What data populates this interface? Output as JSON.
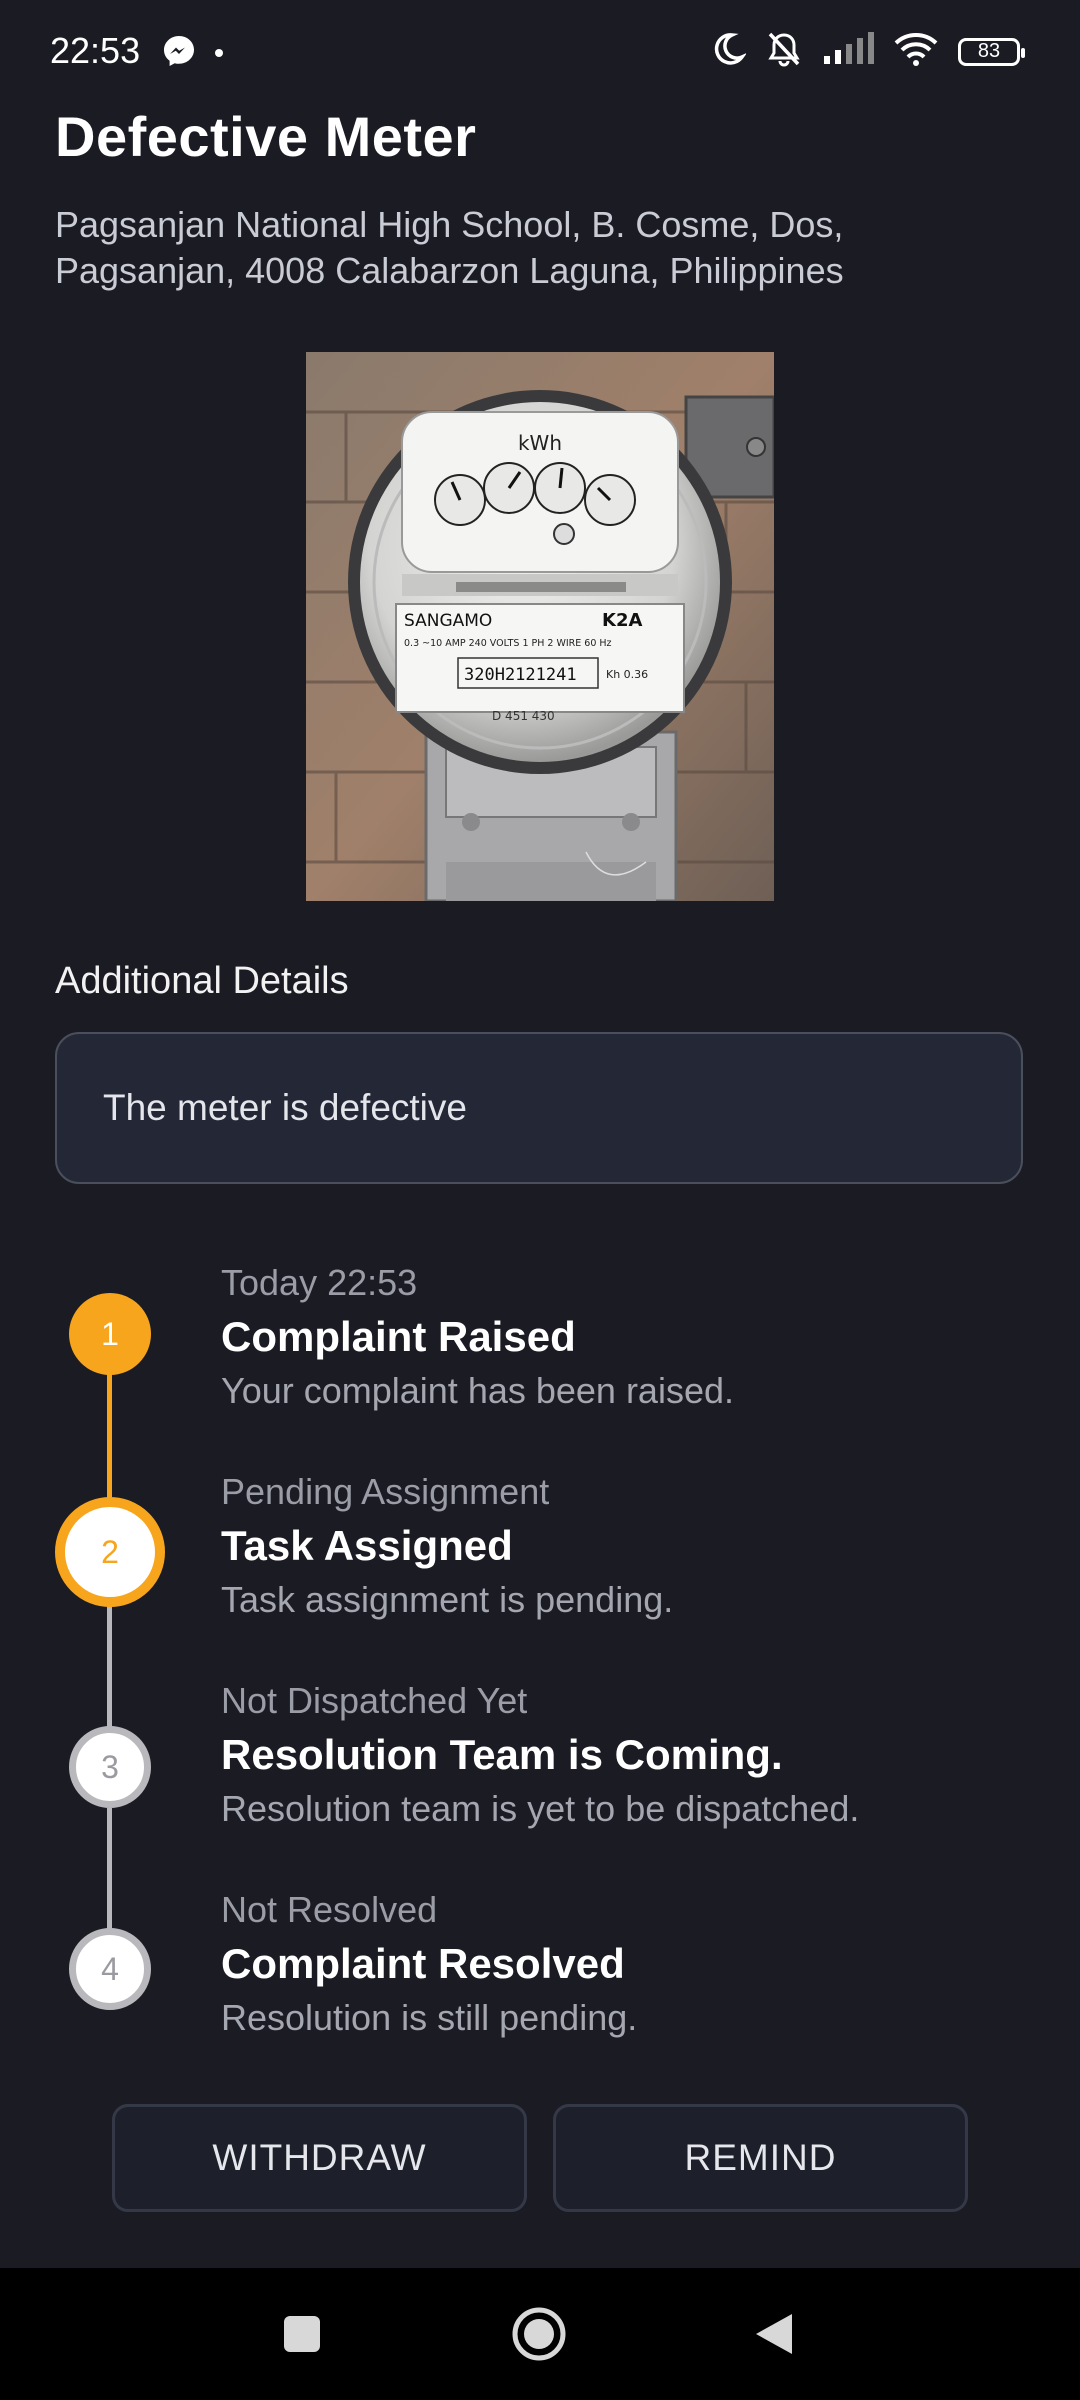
{
  "status_bar": {
    "time": "22:53",
    "battery": "83"
  },
  "page": {
    "title": "Defective Meter",
    "address_line1": "Pagsanjan National High School, B. Cosme, Dos,",
    "address_line2": "Pagsanjan, 4008 Calabarzon Laguna, Philippines"
  },
  "photo": {
    "dial_label": "kWh",
    "brand": "SANGAMO",
    "model": "K2A",
    "spec_line": "0.3 ~10 AMP  240 VOLTS  1 PH  2 WIRE  60 Hz",
    "serial": "320H2121241",
    "kh": "Kh 0.36",
    "number": "D 451 430"
  },
  "details": {
    "label": "Additional Details",
    "text": "The meter is defective"
  },
  "timeline": [
    {
      "number": "1",
      "meta": "Today 22:53",
      "title": "Complaint Raised",
      "desc": "Your complaint has been raised."
    },
    {
      "number": "2",
      "meta": "Pending Assignment",
      "title": "Task Assigned",
      "desc": "Task assignment is pending."
    },
    {
      "number": "3",
      "meta": "Not Dispatched Yet",
      "title": "Resolution Team is Coming.",
      "desc": "Resolution team is yet to be dispatched."
    },
    {
      "number": "4",
      "meta": "Not Resolved",
      "title": "Complaint Resolved",
      "desc": "Resolution is still pending."
    }
  ],
  "actions": {
    "withdraw": "WITHDRAW",
    "remind": "REMIND"
  },
  "colors": {
    "accent": "#f7a51c",
    "inactive": "#b9b9bd",
    "background": "#1b1b24"
  },
  "icons": [
    "messenger-icon",
    "moon-icon",
    "bell-off-icon",
    "signal-icon",
    "wifi-icon",
    "battery-icon",
    "nav-square-icon",
    "nav-home-icon",
    "nav-back-icon"
  ]
}
